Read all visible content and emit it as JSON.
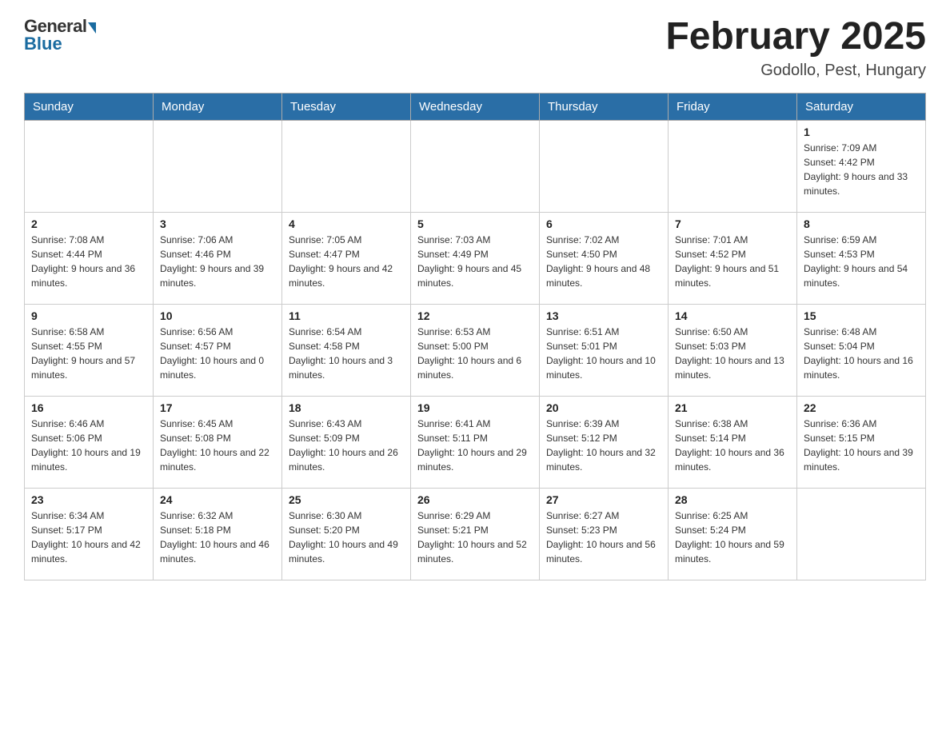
{
  "header": {
    "logo_general": "General",
    "logo_blue": "Blue",
    "month_title": "February 2025",
    "location": "Godollo, Pest, Hungary"
  },
  "days_of_week": [
    "Sunday",
    "Monday",
    "Tuesday",
    "Wednesday",
    "Thursday",
    "Friday",
    "Saturday"
  ],
  "weeks": [
    [
      {
        "day": "",
        "info": ""
      },
      {
        "day": "",
        "info": ""
      },
      {
        "day": "",
        "info": ""
      },
      {
        "day": "",
        "info": ""
      },
      {
        "day": "",
        "info": ""
      },
      {
        "day": "",
        "info": ""
      },
      {
        "day": "1",
        "info": "Sunrise: 7:09 AM\nSunset: 4:42 PM\nDaylight: 9 hours and 33 minutes."
      }
    ],
    [
      {
        "day": "2",
        "info": "Sunrise: 7:08 AM\nSunset: 4:44 PM\nDaylight: 9 hours and 36 minutes."
      },
      {
        "day": "3",
        "info": "Sunrise: 7:06 AM\nSunset: 4:46 PM\nDaylight: 9 hours and 39 minutes."
      },
      {
        "day": "4",
        "info": "Sunrise: 7:05 AM\nSunset: 4:47 PM\nDaylight: 9 hours and 42 minutes."
      },
      {
        "day": "5",
        "info": "Sunrise: 7:03 AM\nSunset: 4:49 PM\nDaylight: 9 hours and 45 minutes."
      },
      {
        "day": "6",
        "info": "Sunrise: 7:02 AM\nSunset: 4:50 PM\nDaylight: 9 hours and 48 minutes."
      },
      {
        "day": "7",
        "info": "Sunrise: 7:01 AM\nSunset: 4:52 PM\nDaylight: 9 hours and 51 minutes."
      },
      {
        "day": "8",
        "info": "Sunrise: 6:59 AM\nSunset: 4:53 PM\nDaylight: 9 hours and 54 minutes."
      }
    ],
    [
      {
        "day": "9",
        "info": "Sunrise: 6:58 AM\nSunset: 4:55 PM\nDaylight: 9 hours and 57 minutes."
      },
      {
        "day": "10",
        "info": "Sunrise: 6:56 AM\nSunset: 4:57 PM\nDaylight: 10 hours and 0 minutes."
      },
      {
        "day": "11",
        "info": "Sunrise: 6:54 AM\nSunset: 4:58 PM\nDaylight: 10 hours and 3 minutes."
      },
      {
        "day": "12",
        "info": "Sunrise: 6:53 AM\nSunset: 5:00 PM\nDaylight: 10 hours and 6 minutes."
      },
      {
        "day": "13",
        "info": "Sunrise: 6:51 AM\nSunset: 5:01 PM\nDaylight: 10 hours and 10 minutes."
      },
      {
        "day": "14",
        "info": "Sunrise: 6:50 AM\nSunset: 5:03 PM\nDaylight: 10 hours and 13 minutes."
      },
      {
        "day": "15",
        "info": "Sunrise: 6:48 AM\nSunset: 5:04 PM\nDaylight: 10 hours and 16 minutes."
      }
    ],
    [
      {
        "day": "16",
        "info": "Sunrise: 6:46 AM\nSunset: 5:06 PM\nDaylight: 10 hours and 19 minutes."
      },
      {
        "day": "17",
        "info": "Sunrise: 6:45 AM\nSunset: 5:08 PM\nDaylight: 10 hours and 22 minutes."
      },
      {
        "day": "18",
        "info": "Sunrise: 6:43 AM\nSunset: 5:09 PM\nDaylight: 10 hours and 26 minutes."
      },
      {
        "day": "19",
        "info": "Sunrise: 6:41 AM\nSunset: 5:11 PM\nDaylight: 10 hours and 29 minutes."
      },
      {
        "day": "20",
        "info": "Sunrise: 6:39 AM\nSunset: 5:12 PM\nDaylight: 10 hours and 32 minutes."
      },
      {
        "day": "21",
        "info": "Sunrise: 6:38 AM\nSunset: 5:14 PM\nDaylight: 10 hours and 36 minutes."
      },
      {
        "day": "22",
        "info": "Sunrise: 6:36 AM\nSunset: 5:15 PM\nDaylight: 10 hours and 39 minutes."
      }
    ],
    [
      {
        "day": "23",
        "info": "Sunrise: 6:34 AM\nSunset: 5:17 PM\nDaylight: 10 hours and 42 minutes."
      },
      {
        "day": "24",
        "info": "Sunrise: 6:32 AM\nSunset: 5:18 PM\nDaylight: 10 hours and 46 minutes."
      },
      {
        "day": "25",
        "info": "Sunrise: 6:30 AM\nSunset: 5:20 PM\nDaylight: 10 hours and 49 minutes."
      },
      {
        "day": "26",
        "info": "Sunrise: 6:29 AM\nSunset: 5:21 PM\nDaylight: 10 hours and 52 minutes."
      },
      {
        "day": "27",
        "info": "Sunrise: 6:27 AM\nSunset: 5:23 PM\nDaylight: 10 hours and 56 minutes."
      },
      {
        "day": "28",
        "info": "Sunrise: 6:25 AM\nSunset: 5:24 PM\nDaylight: 10 hours and 59 minutes."
      },
      {
        "day": "",
        "info": ""
      }
    ]
  ]
}
